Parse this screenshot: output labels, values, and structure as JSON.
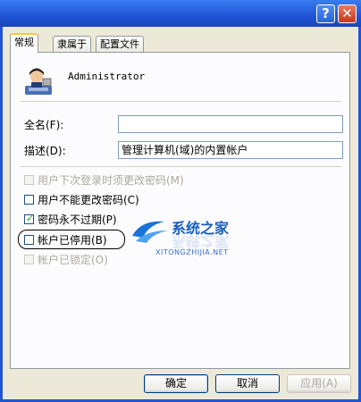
{
  "window": {
    "help_glyph": "?",
    "close_glyph": "✕"
  },
  "tabs": [
    "常规",
    "隶属于",
    "配置文件"
  ],
  "user": {
    "name": "Administrator",
    "icon": "user-icon"
  },
  "fields": {
    "fullname_label": "全名(F):",
    "fullname_value": "",
    "desc_label": "描述(D):",
    "desc_value": "管理计算机(域)的内置帐户"
  },
  "checkboxes": [
    {
      "label": "用户下次登录时须更改密码(M)",
      "checked": false,
      "disabled": true
    },
    {
      "label": "用户不能更改密码(C)",
      "checked": false,
      "disabled": false
    },
    {
      "label": "密码永不过期(P)",
      "checked": true,
      "disabled": false
    },
    {
      "label": "帐户已停用(B)",
      "checked": false,
      "disabled": false
    },
    {
      "label": "帐户已锁定(O)",
      "checked": false,
      "disabled": true
    }
  ],
  "watermark": {
    "title": "系统之家",
    "subtitle": "XITONGZHIJIA.NET"
  },
  "buttons": {
    "ok": "确定",
    "cancel": "取消",
    "apply": "应用(A)"
  },
  "colors": {
    "title_bar": "#1f54d6",
    "dialog_bg": "#ece9d8",
    "check_green": "#21a121"
  }
}
